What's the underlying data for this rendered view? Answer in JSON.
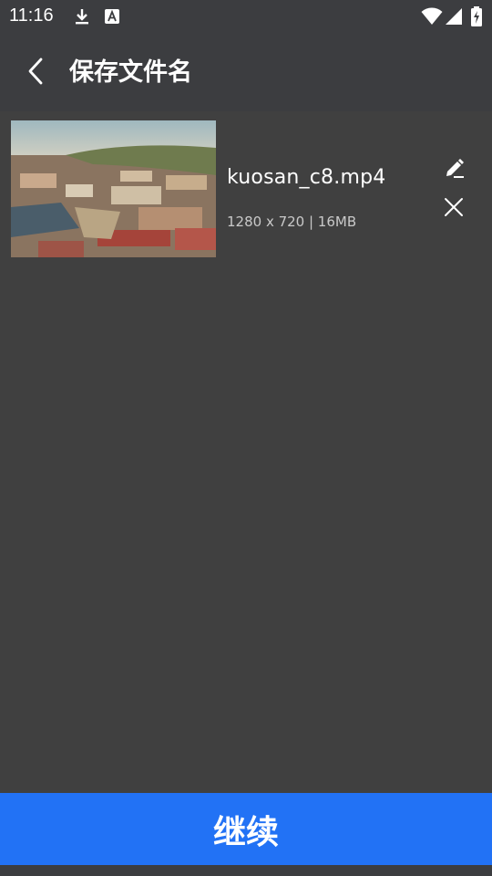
{
  "status_bar": {
    "time": "11:16",
    "left_icons": [
      "download-icon",
      "a-notification-icon"
    ],
    "right_icons": [
      "wifi-icon",
      "cell-signal-icon",
      "battery-charging-icon"
    ]
  },
  "app_bar": {
    "title": "保存文件名",
    "back_icon": "chevron-left-icon"
  },
  "file": {
    "name": "kuosan_c8.mp4",
    "meta": "1280 x 720 | 16MB",
    "edit_icon": "pencil-icon",
    "remove_icon": "close-icon"
  },
  "continue_button": {
    "label": "继续",
    "color": "#2272f5"
  },
  "colors": {
    "background": "#404040",
    "app_bar": "#3c3d40",
    "accent": "#2272f5"
  }
}
